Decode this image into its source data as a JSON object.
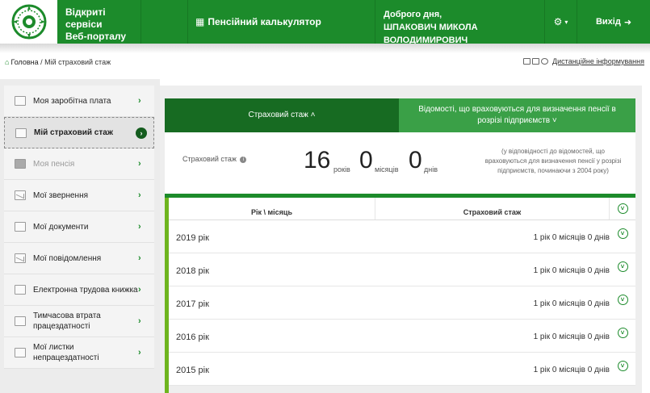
{
  "header": {
    "brand_line1": "Відкриті сервіси",
    "brand_line2": "Веб-порталу",
    "calculator": "Пенсійний калькулятор",
    "greeting": "Доброго дня,",
    "user_name": "ШПАКОВИЧ МИКОЛА ВОЛОДИМИРОВИЧ",
    "settings_caret": "▾",
    "logout": "Вихід"
  },
  "breadcrumb": {
    "home": "Головна",
    "separator": " / ",
    "current": "Мій страховий стаж"
  },
  "remote": "Дистанційне інформування",
  "sidebar": {
    "items": [
      {
        "label": "Моя заробітна плата",
        "icon": "wallet-icon"
      },
      {
        "label": "Мій страховий стаж",
        "icon": "calendar-icon",
        "active": true
      },
      {
        "label": "Моя пенсія",
        "icon": "folder-icon",
        "muted": true
      },
      {
        "label": "Мої звернення",
        "icon": "envelope-icon"
      },
      {
        "label": "Мої документи",
        "icon": "document-icon"
      },
      {
        "label": "Мої повідомлення",
        "icon": "envelope-icon"
      },
      {
        "label": "Електронна трудова книжка",
        "icon": "book-icon"
      },
      {
        "label": "Тимчасова втрата працездатності",
        "icon": "book-icon"
      },
      {
        "label": "Мої листки непрацездатності",
        "icon": "book-icon"
      }
    ]
  },
  "tabs": {
    "t1": "Страховий стаж ˄",
    "t2": "Відомості, що враховуються для визначення пенсії в розрізі підприємств ˅"
  },
  "summary": {
    "label": "Страховий стаж",
    "years": "16",
    "years_unit": "років",
    "months": "0",
    "months_unit": "місяців",
    "days": "0",
    "days_unit": "днів",
    "note": "(у відповідності до відомостей, що враховуються для визначення пенсії у розрізі підприємств, починаючи з 2004 року)"
  },
  "table": {
    "col_year": "Рік \\ місяць",
    "col_stage": "Страховий стаж",
    "rows": [
      {
        "year": "2019 рік",
        "value": "1 рік 0 місяців 0 днів"
      },
      {
        "year": "2018 рік",
        "value": "1 рік 0 місяців 0 днів"
      },
      {
        "year": "2017 рік",
        "value": "1 рік 0 місяців 0 днів"
      },
      {
        "year": "2016 рік",
        "value": "1 рік 0 місяців 0 днів"
      },
      {
        "year": "2015 рік",
        "value": "1 рік 0 місяців 0 днів"
      }
    ]
  },
  "colors": {
    "header_green": "#1c8b2b",
    "tab_dark": "#176b22",
    "tab_light": "#3aa047",
    "accent_lime": "#6eb51f"
  }
}
